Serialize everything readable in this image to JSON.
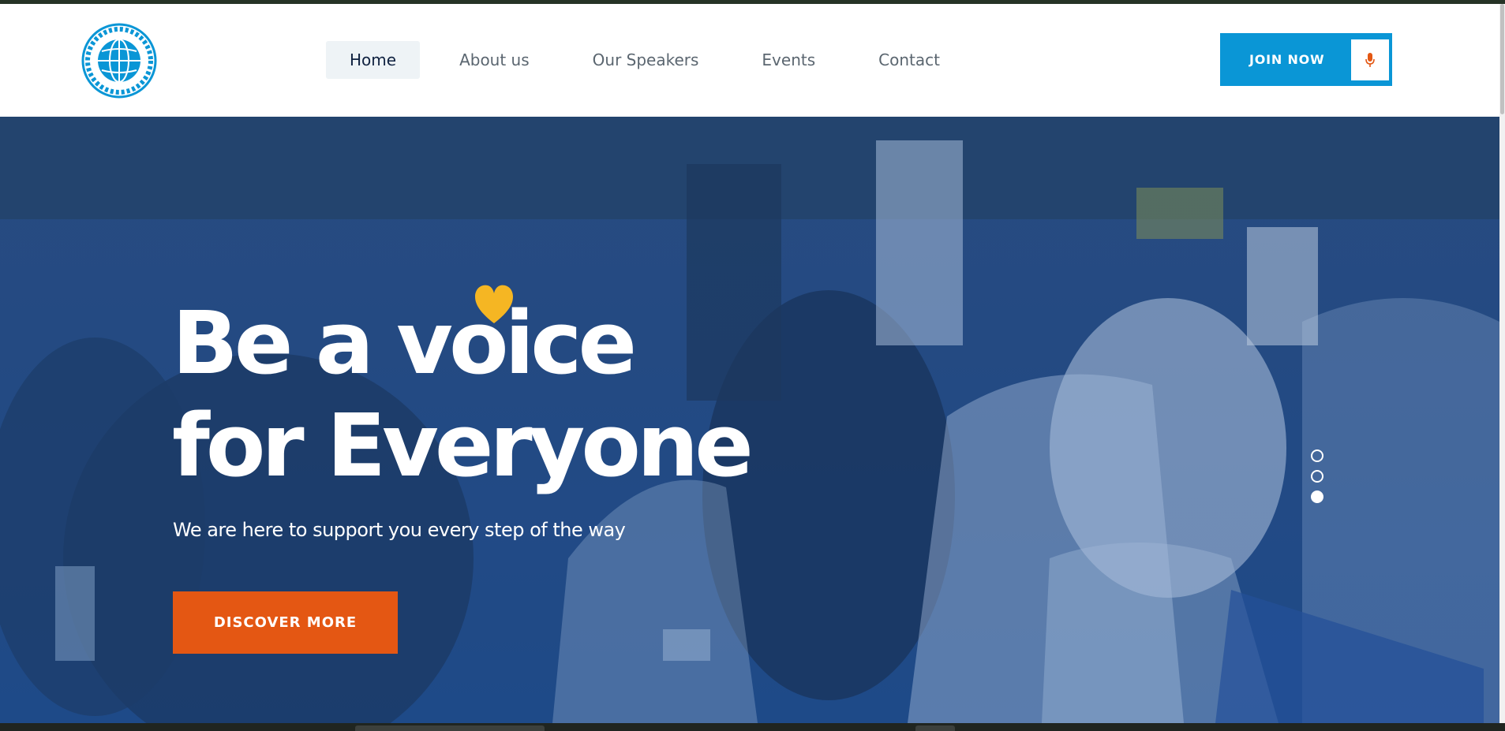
{
  "header": {
    "logo_alt": "GFD DIPLOMACY",
    "nav": [
      {
        "label": "Home",
        "active": true
      },
      {
        "label": "About us",
        "active": false
      },
      {
        "label": "Our Speakers",
        "active": false
      },
      {
        "label": "Events",
        "active": false
      },
      {
        "label": "Contact",
        "active": false
      }
    ],
    "join_button": {
      "label": "JOIN NOW",
      "icon": "microphone-icon"
    }
  },
  "hero": {
    "headline_line1": "Be a voice",
    "headline_line2": "for Everyone",
    "subtitle": "We are here to support you every step of the way",
    "cta_label": "DISCOVER MORE",
    "slides_total": 3,
    "active_slide": 3
  },
  "colors": {
    "brand_blue": "#0a96d6",
    "hero_overlay": "#24497f",
    "cta_orange": "#e45713",
    "heart_yellow": "#f5b623",
    "nav_active_bg": "#eef3f6"
  }
}
